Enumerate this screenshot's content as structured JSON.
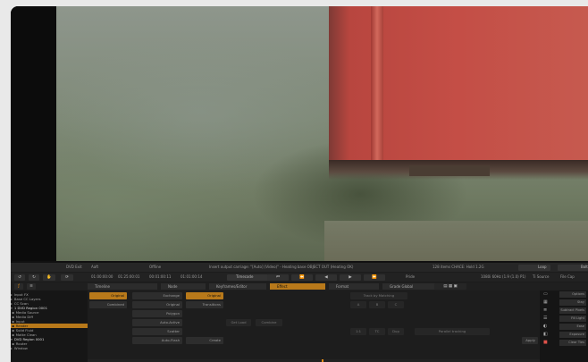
{
  "toolbar_top": {
    "left_label": "DVD Exit",
    "name_label": "Aaft",
    "status": "Offline",
    "message": "Insert output carriage: \"[Auto] (Video)\" - Heating base OBJECT OUT (Heating OK)",
    "cache": "128 items CHACE: Hold 1.2G",
    "ctrl1": "Loop",
    "ctrl2": "Bolt"
  },
  "timecodes": {
    "tc1": "01:00:00:00",
    "tc2": "01:25:00:01",
    "tc3": "00:01:00:11",
    "tc4": "01:01:00:14",
    "timecode_btn": "Timecode",
    "mode": "Pride",
    "res_info": "1080i 60Hz (1.9 (1.0) P1)",
    "trail": "Ti Source",
    "trail2": "File Cap"
  },
  "timeline_row": {
    "label_a": "Ba",
    "label_b": "Double",
    "label_c": "BGSL"
  },
  "tabs": [
    {
      "label": "Timeline",
      "active": false
    },
    {
      "label": "Node",
      "active": false
    },
    {
      "label": "Keyframes/Editor",
      "active": false
    },
    {
      "label": "Effect",
      "active": true
    },
    {
      "label": "Format",
      "active": false
    },
    {
      "label": "Grade Global",
      "active": false
    }
  ],
  "tree": [
    {
      "label": "Input FX",
      "selected": false
    },
    {
      "label": "Base CC Layers",
      "selected": false
    },
    {
      "label": "CC Scan",
      "selected": false
    },
    {
      "label": "1 DVD Region 0001",
      "selected": false
    },
    {
      "label": "Media Source",
      "selected": false
    },
    {
      "label": "Media Diff",
      "selected": false
    },
    {
      "label": "Input",
      "selected": false
    },
    {
      "label": "Render",
      "selected": true
    },
    {
      "label": "Solid Fluid",
      "selected": false
    },
    {
      "label": "Matte Clean",
      "selected": false
    },
    {
      "label": "DVD Region 0001",
      "selected": false
    },
    {
      "label": "Router",
      "selected": false
    },
    {
      "label": "Window",
      "selected": false
    }
  ],
  "content": {
    "col1": [
      "Original",
      "Combined"
    ],
    "col2": [
      "Exchange",
      "Original",
      "Polygon",
      "Auto-Active",
      "Scatter",
      "Auto-Flash"
    ],
    "col3": [
      "Original",
      "Transitions"
    ],
    "mid": [
      "Get Load",
      "Combine"
    ],
    "create_label": "Create",
    "right_top": "Track by Matching",
    "right_btns": [
      "A",
      "B",
      "C"
    ],
    "right_lower": [
      "1:1",
      "TC",
      "Dup"
    ],
    "tracking": "Parallel tracking",
    "apply": "Apply"
  },
  "rightcol": [
    "Options",
    "Stay",
    "Subtract Pixels",
    "Fill Light",
    "Ease",
    "Exposure",
    "Clear Ties"
  ]
}
